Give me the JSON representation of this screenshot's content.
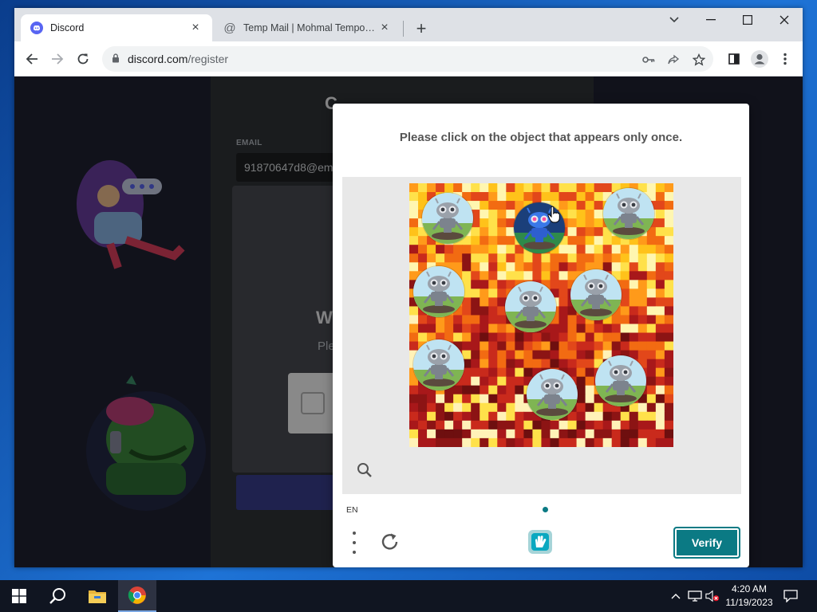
{
  "browser": {
    "tabs": [
      {
        "title": "Discord",
        "active": true
      },
      {
        "title": "Temp Mail | Mohmal Temporary E",
        "active": false
      }
    ],
    "new_tab_symbol": "+",
    "url_domain": "discord.com",
    "url_path": "/register",
    "icons": [
      "back-icon",
      "forward-icon",
      "reload-icon",
      "lock-icon",
      "key-icon",
      "share-icon",
      "star-icon",
      "side-panel-icon",
      "profile-icon",
      "more-icon"
    ]
  },
  "page": {
    "partial_title": "C",
    "email_label": "EMAIL",
    "email_value": "91870647d8@em",
    "welcome_partial": "W",
    "please_partial": "Ple",
    "brand_color": "#5865f2"
  },
  "captcha": {
    "prompt": "Please click on the object that appears only once.",
    "language": "EN",
    "verify_label": "Verify",
    "accent_color": "#0b7a84",
    "robots": [
      {
        "variant": "gray"
      },
      {
        "variant": "blue"
      },
      {
        "variant": "gray"
      },
      {
        "variant": "gray"
      },
      {
        "variant": "gray"
      },
      {
        "variant": "gray"
      },
      {
        "variant": "gray"
      },
      {
        "variant": "gray"
      },
      {
        "variant": "gray"
      }
    ],
    "icons": [
      "zoom-icon",
      "menu-dots-icon",
      "refresh-icon",
      "hcaptcha-logo-icon"
    ]
  },
  "taskbar": {
    "items": [
      "start-icon",
      "search-icon",
      "file-explorer-icon",
      "chrome-icon"
    ],
    "time": "4:20 AM",
    "date": "11/19/2023"
  }
}
